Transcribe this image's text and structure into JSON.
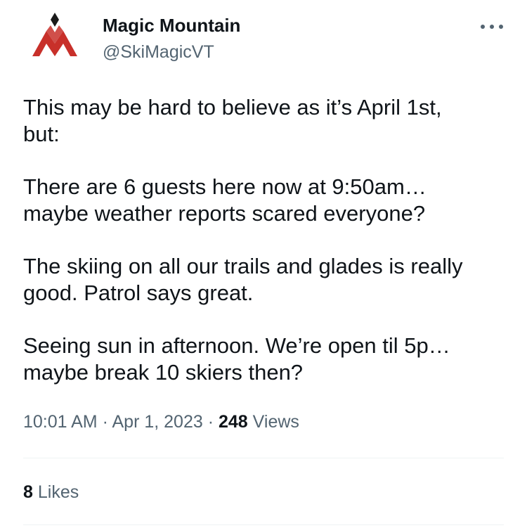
{
  "author": {
    "display_name": "Magic Mountain",
    "handle": "@SkiMagicVT",
    "avatar_icon": "magic-mountain-logo-icon",
    "logo_colors": {
      "red": "#c8302a",
      "black": "#1a1a1a"
    }
  },
  "more_icon": "more-options-icon",
  "tweet": {
    "paragraphs": [
      "This may be hard to believe as it’s April 1st,\nbut:",
      "There are 6 guests here now at 9:50am…\nmaybe weather reports scared everyone?",
      "The skiing on all our trails and glades is really\ngood. Patrol says great.",
      "Seeing sun in afternoon. We’re open til 5p…\nmaybe break 10 skiers then?"
    ]
  },
  "meta": {
    "time": "10:01 AM",
    "separator": "·",
    "date": "Apr 1, 2023",
    "views_count": "248",
    "views_label": "Views"
  },
  "likes": {
    "count": "8",
    "label": "Likes"
  }
}
